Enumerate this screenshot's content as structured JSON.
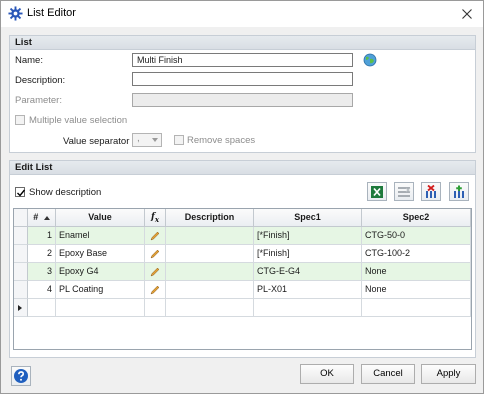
{
  "window": {
    "title": "List Editor"
  },
  "list_section": {
    "header": "List",
    "name_label": "Name:",
    "name_value": "Multi Finish",
    "description_label": "Description:",
    "description_value": "",
    "parameter_label": "Parameter:",
    "parameter_value": "",
    "multiple_value_label": "Multiple value selection",
    "value_separator_label": "Value separator",
    "value_separator_value": ",",
    "remove_spaces_label": "Remove spaces"
  },
  "edit_section": {
    "header": "Edit List",
    "show_description_label": "Show description",
    "show_description_checked": true
  },
  "grid": {
    "columns": {
      "num": "#",
      "value": "Value",
      "fx": "f",
      "fx_sub": "x",
      "description": "Description",
      "spec1": "Spec1",
      "spec2": "Spec2"
    },
    "rows": [
      {
        "num": "1",
        "value": "Enamel",
        "description": "",
        "spec1": "[*Finish]",
        "spec2": "CTG-50-0"
      },
      {
        "num": "2",
        "value": "Epoxy Base",
        "description": "",
        "spec1": "[*Finish]",
        "spec2": "CTG-100-2"
      },
      {
        "num": "3",
        "value": "Epoxy G4",
        "description": "",
        "spec1": "CTG-E-G4",
        "spec2": "None"
      },
      {
        "num": "4",
        "value": "PL Coating",
        "description": "",
        "spec1": "PL-X01",
        "spec2": "None"
      }
    ]
  },
  "footer": {
    "ok_label": "OK",
    "cancel_label": "Cancel",
    "apply_label": "Apply"
  },
  "colors": {
    "row_alt": "#e6f6e4",
    "section_header": "#dde2e7",
    "excel_green": "#1e7a3c"
  }
}
